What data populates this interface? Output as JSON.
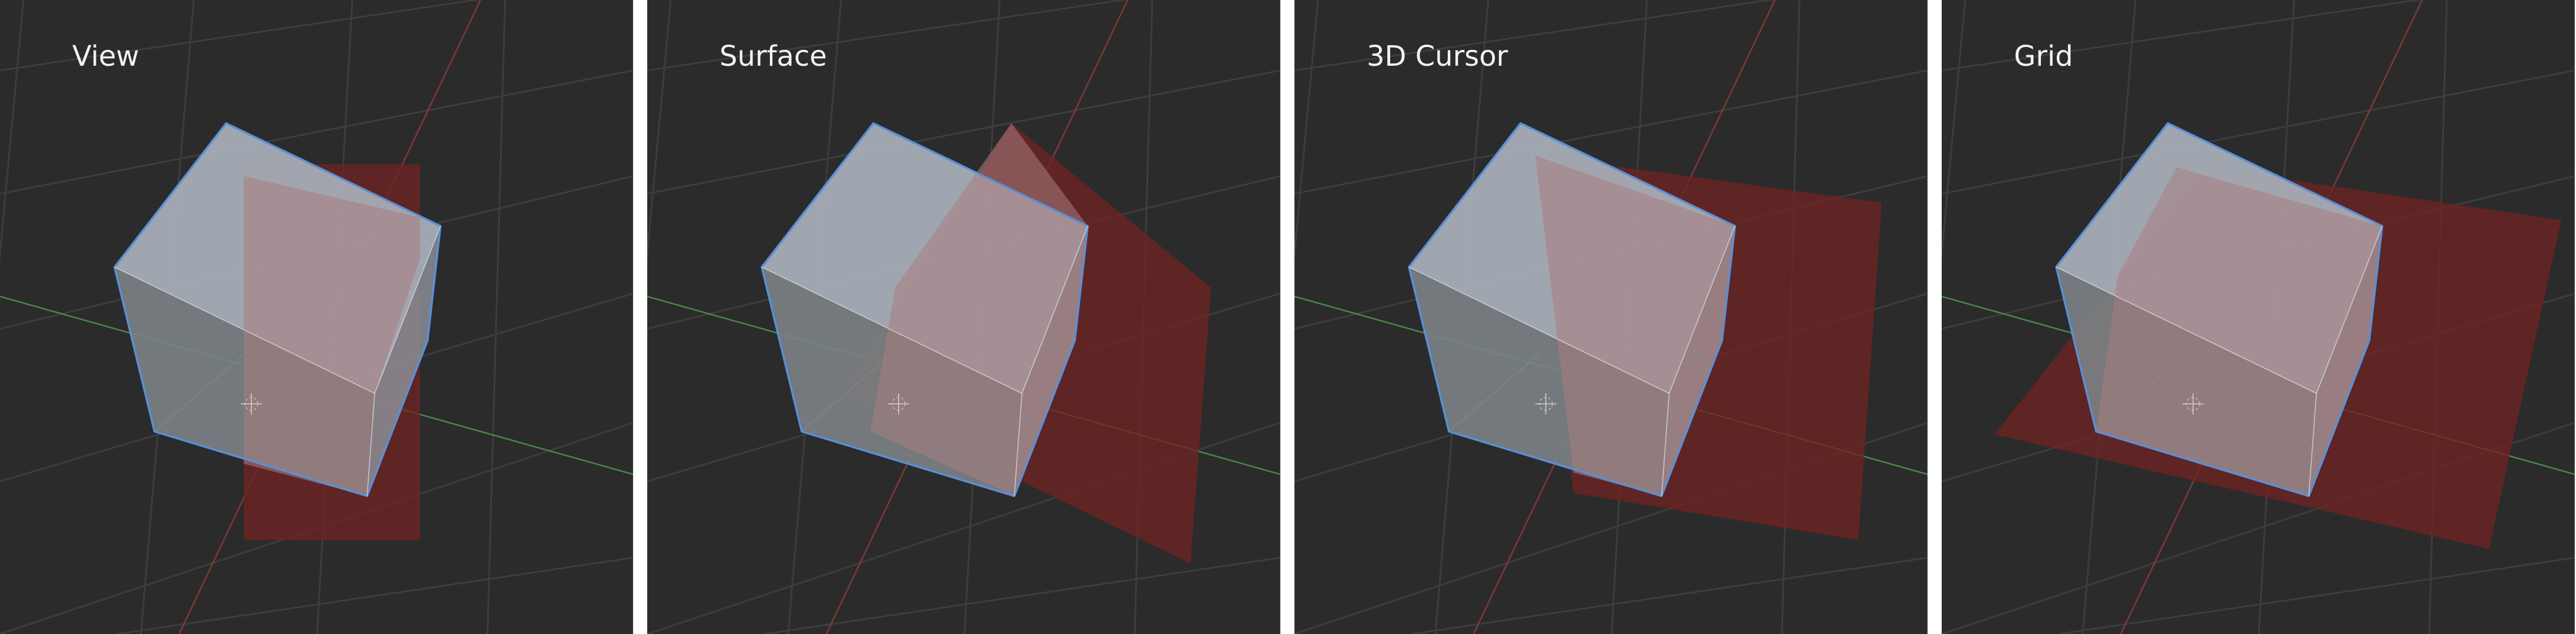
{
  "panels": [
    {
      "id": "view",
      "title": "View",
      "plane_shape": "view"
    },
    {
      "id": "surface",
      "title": "Surface",
      "plane_shape": "surface"
    },
    {
      "id": "cursor",
      "title": "3D Cursor",
      "plane_shape": "cursor"
    },
    {
      "id": "grid",
      "title": "Grid",
      "plane_shape": "grid"
    }
  ],
  "colors": {
    "background": "#2b2b2b",
    "separator": "#ffffff",
    "grid_line": "#3d3d3d",
    "x_axis": "#9a3b3b",
    "y_axis": "#4f9e4f",
    "cube_face_top": "#a9b1bb",
    "cube_face_left": "#7d8487",
    "cube_face_right": "#8f959c",
    "cube_edge": "#5a8fd6",
    "plane_fill": "#6e2323",
    "label": "#f2f2f2"
  }
}
